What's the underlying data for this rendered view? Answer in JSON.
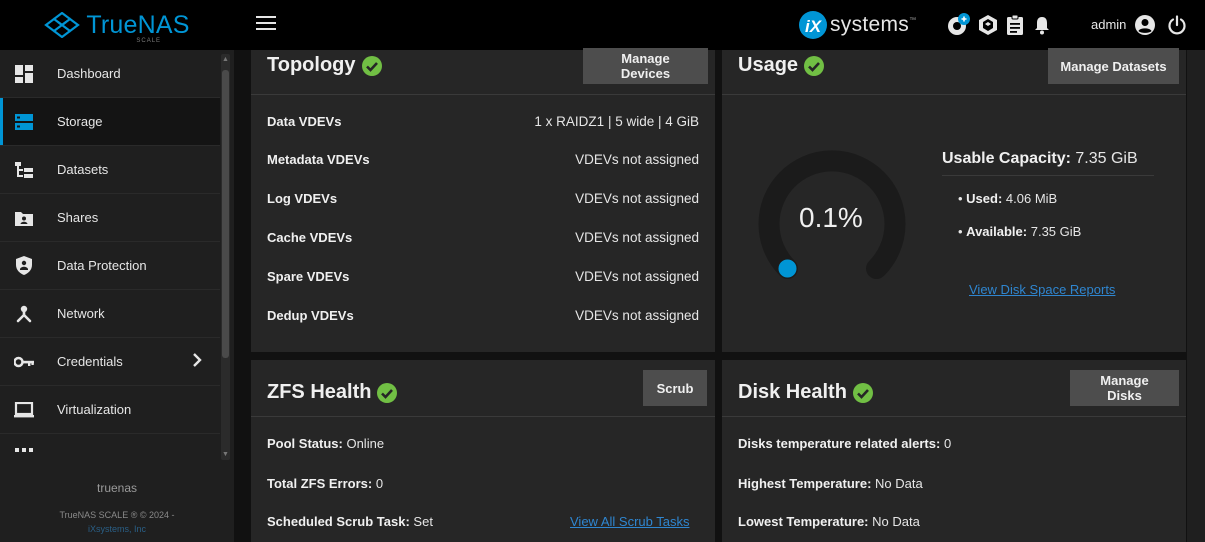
{
  "header": {
    "logo_text": "TrueNAS",
    "logo_sub": "SCALE",
    "vendor_text": "systems",
    "vendor_tm": "™",
    "user": "admin",
    "icons": [
      "menu-icon",
      "ix-badge-icon",
      "update-icon",
      "truecommand-icon",
      "jobs-clipboard-icon",
      "alerts-bell-icon",
      "account-icon",
      "power-icon"
    ]
  },
  "sidebar": {
    "items": [
      {
        "label": "Dashboard",
        "icon": "dashboard-icon"
      },
      {
        "label": "Storage",
        "icon": "storage-icon",
        "active": true
      },
      {
        "label": "Datasets",
        "icon": "datasets-icon"
      },
      {
        "label": "Shares",
        "icon": "shares-icon"
      },
      {
        "label": "Data Protection",
        "icon": "data-protection-icon"
      },
      {
        "label": "Network",
        "icon": "network-icon"
      },
      {
        "label": "Credentials",
        "icon": "credentials-icon",
        "chevron": "›"
      },
      {
        "label": "Virtualization",
        "icon": "virtualization-icon"
      },
      {
        "label": "",
        "icon": "more-icon"
      }
    ],
    "hostname": "truenas",
    "copyright": "TrueNAS SCALE ® © 2024 -",
    "copyright_link": "iXsystems, Inc"
  },
  "topology": {
    "title": "Topology",
    "button": "Manage Devices",
    "rows": [
      {
        "label": "Data VDEVs",
        "value": "1 x RAIDZ1 | 5 wide | 4 GiB"
      },
      {
        "label": "Metadata VDEVs",
        "value": "VDEVs not assigned"
      },
      {
        "label": "Log VDEVs",
        "value": "VDEVs not assigned"
      },
      {
        "label": "Cache VDEVs",
        "value": "VDEVs not assigned"
      },
      {
        "label": "Spare VDEVs",
        "value": "VDEVs not assigned"
      },
      {
        "label": "Dedup VDEVs",
        "value": "VDEVs not assigned"
      }
    ]
  },
  "usage": {
    "title": "Usage",
    "button": "Manage Datasets",
    "percent": "0.1%",
    "percent_value": 0.1,
    "capacity_label": "Usable Capacity:",
    "capacity_value": "7.35 GiB",
    "used_label": "Used:",
    "used_value": "4.06 MiB",
    "available_label": "Available:",
    "available_value": "7.35 GiB",
    "report_link": "View Disk Space Reports"
  },
  "zfs_health": {
    "title": "ZFS Health",
    "button": "Scrub",
    "pool_status_label": "Pool Status:",
    "pool_status_value": "Online",
    "errors_label": "Total ZFS Errors:",
    "errors_value": "0",
    "scrub_task_label": "Scheduled Scrub Task:",
    "scrub_task_value": "Set",
    "scrub_link": "View All Scrub Tasks"
  },
  "disk_health": {
    "title": "Disk Health",
    "button": "Manage Disks",
    "temp_alerts_label": "Disks temperature related alerts:",
    "temp_alerts_value": "0",
    "highest_label": "Highest Temperature:",
    "highest_value": "No Data",
    "lowest_label": "Lowest Temperature:",
    "lowest_value": "No Data"
  },
  "colors": {
    "accent": "#0095d5",
    "ok_green": "#71bf44",
    "background": "#111111",
    "card": "#262626",
    "button": "#4d4d4d"
  }
}
